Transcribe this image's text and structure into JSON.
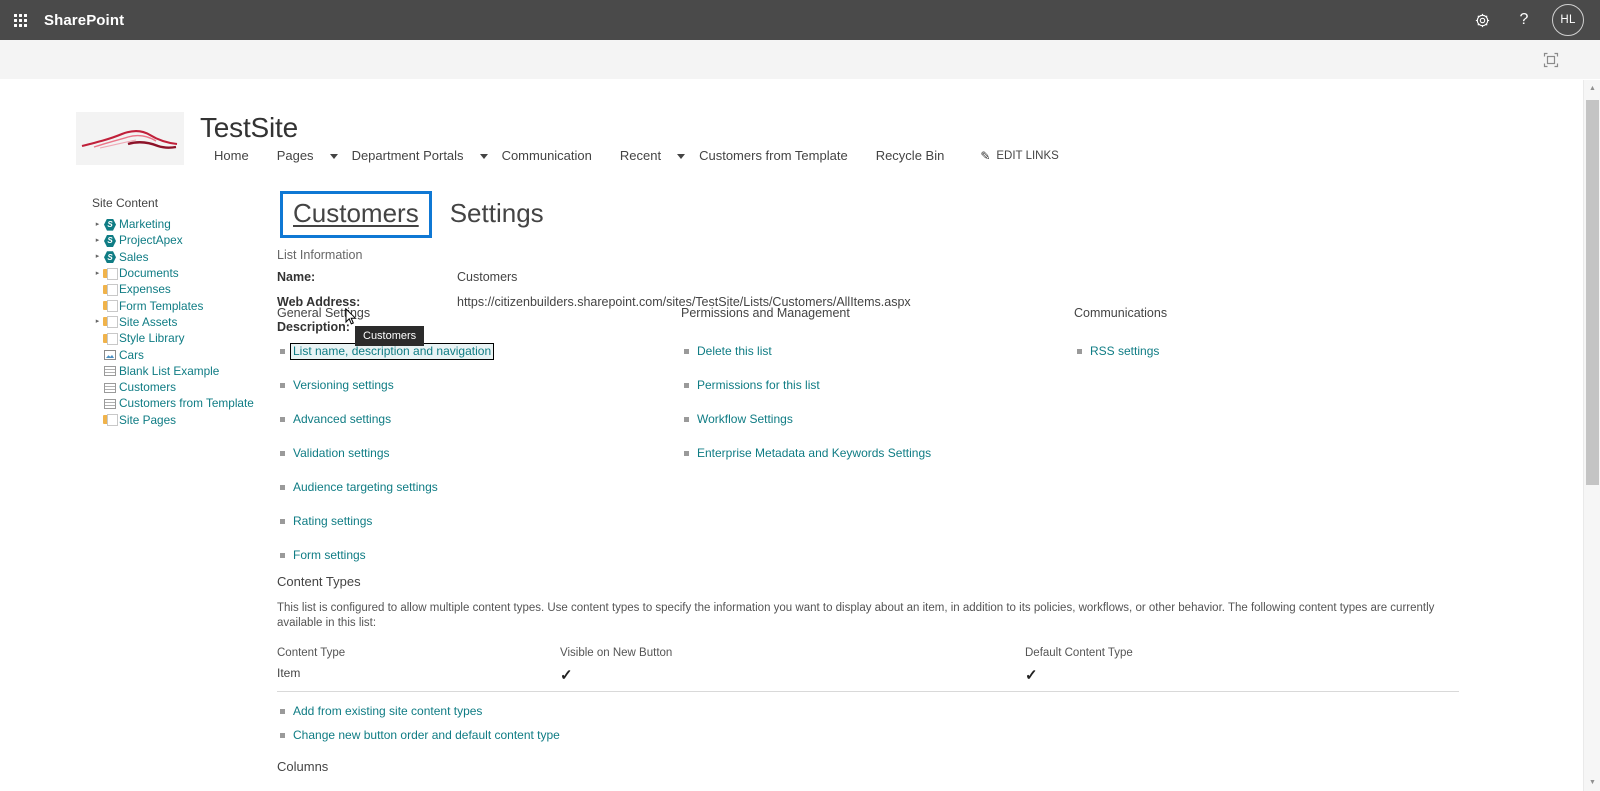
{
  "suite_bar": {
    "waffle_label": "app-launcher",
    "brand": "SharePoint",
    "settings_icon": "gear-icon",
    "help_icon": "help-icon",
    "avatar_initials": "HL"
  },
  "ribbon_strip": {
    "focus_icon": "focus-on-content-icon"
  },
  "site_header": {
    "logo_alt": "site-logo-car",
    "title": "TestSite",
    "nav": [
      {
        "label": "Home",
        "has_caret": false
      },
      {
        "label": "Pages",
        "has_caret": true
      },
      {
        "label": "Department Portals",
        "has_caret": true
      },
      {
        "label": "Communication",
        "has_caret": false
      },
      {
        "label": "Recent",
        "has_caret": true
      },
      {
        "label": "Customers from Template",
        "has_caret": false
      },
      {
        "label": "Recycle Bin",
        "has_caret": false
      }
    ],
    "edit_links": "EDIT LINKS",
    "edit_links_icon": "pencil-icon"
  },
  "quick_launch": {
    "title": "Site Content",
    "items": [
      {
        "label": "Marketing",
        "icon": "sharepoint-site-icon",
        "expandable": true
      },
      {
        "label": "ProjectApex",
        "icon": "sharepoint-site-icon",
        "expandable": true
      },
      {
        "label": "Sales",
        "icon": "sharepoint-site-icon",
        "expandable": true
      },
      {
        "label": "Documents",
        "icon": "document-library-icon",
        "expandable": true
      },
      {
        "label": "Expenses",
        "icon": "document-library-icon",
        "expandable": false
      },
      {
        "label": "Form Templates",
        "icon": "document-library-icon",
        "expandable": false
      },
      {
        "label": "Site Assets",
        "icon": "document-library-icon",
        "expandable": true
      },
      {
        "label": "Style Library",
        "icon": "document-library-icon",
        "expandable": false
      },
      {
        "label": "Cars",
        "icon": "picture-library-icon",
        "expandable": false
      },
      {
        "label": "Blank List Example",
        "icon": "list-icon",
        "expandable": false
      },
      {
        "label": "Customers",
        "icon": "list-icon",
        "expandable": false
      },
      {
        "label": "Customers from Template",
        "icon": "list-icon",
        "expandable": false
      },
      {
        "label": "Site Pages",
        "icon": "document-library-icon",
        "expandable": false
      }
    ]
  },
  "tabs": {
    "customers": "Customers",
    "settings": "Settings",
    "tooltip": "Customers",
    "focus_color": "#0f78d4"
  },
  "list_information": {
    "heading": "List Information",
    "name_label": "Name:",
    "name_value": "Customers",
    "web_address_label": "Web Address:",
    "web_address_value": "https://citizenbuilders.sharepoint.com/sites/TestSite/Lists/Customers/AllItems.aspx",
    "description_label": "Description:",
    "description_value": ""
  },
  "settings_columns": [
    {
      "heading": "General Settings",
      "links": [
        {
          "label": "List name, description and navigation",
          "focused": true
        },
        {
          "label": "Versioning settings",
          "focused": false
        },
        {
          "label": "Advanced settings",
          "focused": false
        },
        {
          "label": "Validation settings",
          "focused": false
        },
        {
          "label": "Audience targeting settings",
          "focused": false
        },
        {
          "label": "Rating settings",
          "focused": false
        },
        {
          "label": "Form settings",
          "focused": false
        }
      ]
    },
    {
      "heading": "Permissions and Management",
      "links": [
        {
          "label": "Delete this list",
          "focused": false
        },
        {
          "label": "Permissions for this list",
          "focused": false
        },
        {
          "label": "Workflow Settings",
          "focused": false
        },
        {
          "label": "Enterprise Metadata and Keywords Settings",
          "focused": false
        }
      ]
    },
    {
      "heading": "Communications",
      "links": [
        {
          "label": "RSS settings",
          "focused": false
        }
      ]
    }
  ],
  "content_types": {
    "title": "Content Types",
    "description": "This list is configured to allow multiple content types. Use content types to specify the information you want to display about an item, in addition to its policies, workflows, or other behavior. The following content types are currently available in this list:",
    "headers": [
      "Content Type",
      "Visible on New Button",
      "Default Content Type"
    ],
    "rows": [
      {
        "content_type": "Item",
        "visible_on_new_button": "✓",
        "default_content_type": "✓"
      }
    ],
    "links": [
      {
        "label": "Add from existing site content types"
      },
      {
        "label": "Change new button order and default content type"
      }
    ]
  },
  "columns_section": {
    "title": "Columns"
  },
  "scrollbar": {
    "up_arrow": "scroll-up-icon",
    "down_arrow": "scroll-down-icon"
  }
}
